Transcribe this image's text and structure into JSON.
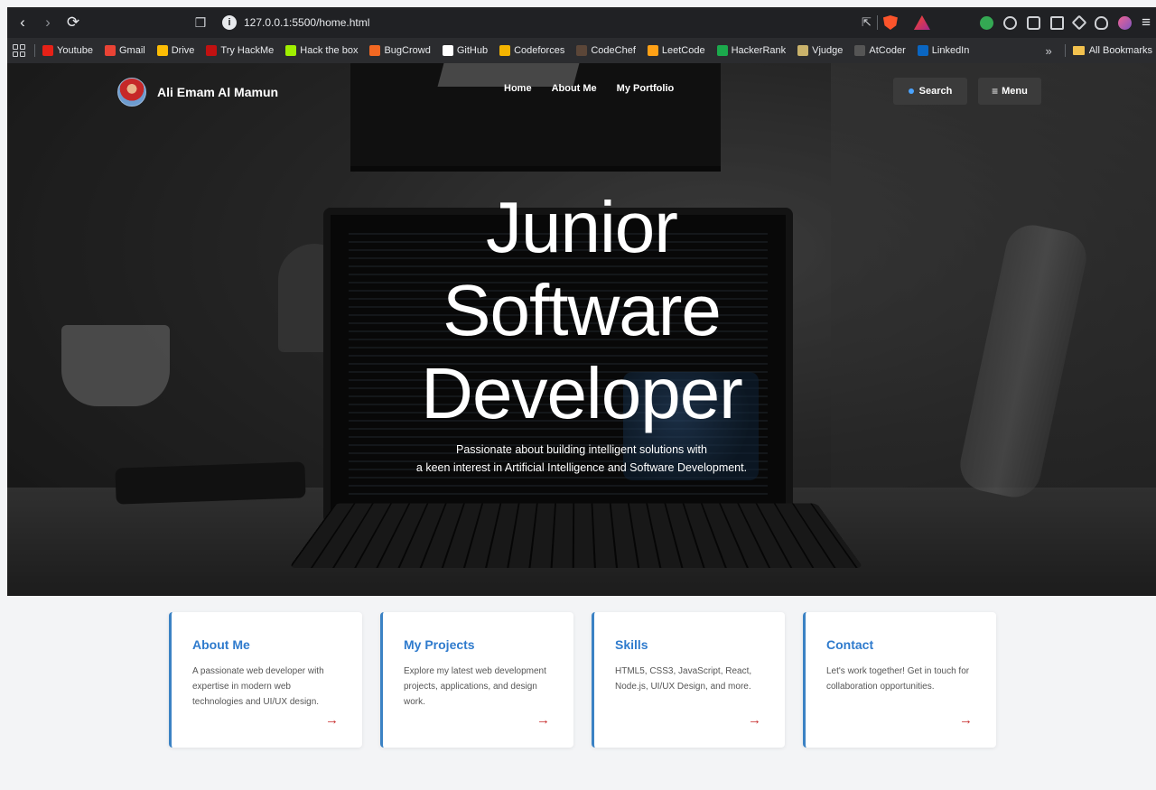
{
  "browser": {
    "url": "127.0.0.1:5500/home.html",
    "bookmarks": [
      {
        "label": "Youtube",
        "icon": "youtube-icon",
        "color": "#e62117"
      },
      {
        "label": "Gmail",
        "icon": "gmail-icon",
        "color": "#ea4335"
      },
      {
        "label": "Drive",
        "icon": "drive-icon",
        "color": "#fbbc04"
      },
      {
        "label": "Try HackMe",
        "icon": "tryhackme-icon",
        "color": "#c11111"
      },
      {
        "label": "Hack the box",
        "icon": "hackthebox-icon",
        "color": "#9fef00"
      },
      {
        "label": "BugCrowd",
        "icon": "bugcrowd-icon",
        "color": "#f26822"
      },
      {
        "label": "GitHub",
        "icon": "github-icon",
        "color": "#ffffff"
      },
      {
        "label": "Codeforces",
        "icon": "codeforces-icon",
        "color": "#f4b400"
      },
      {
        "label": "CodeChef",
        "icon": "codechef-icon",
        "color": "#5b4638"
      },
      {
        "label": "LeetCode",
        "icon": "leetcode-icon",
        "color": "#ffa116"
      },
      {
        "label": "HackerRank",
        "icon": "hackerrank-icon",
        "color": "#1ba94c"
      },
      {
        "label": "Vjudge",
        "icon": "vjudge-icon",
        "color": "#c9b26b"
      },
      {
        "label": "AtCoder",
        "icon": "atcoder-icon",
        "color": "#555555"
      },
      {
        "label": "LinkedIn",
        "icon": "linkedin-icon",
        "color": "#0a66c2"
      }
    ],
    "overflow": "»",
    "all_bookmarks": "All Bookmarks"
  },
  "site": {
    "brand": "Ali Emam Al Mamun",
    "nav": [
      "Home",
      "About Me",
      "My Portfolio"
    ],
    "search_label": "Search",
    "menu_label": "Menu",
    "hero": {
      "title_lines": [
        "Junior",
        "Software",
        "Developer"
      ],
      "subtitle_lines": [
        "Passionate about building intelligent solutions with",
        "a keen interest in Artificial Intelligence and Software Development."
      ]
    },
    "cards": [
      {
        "title": "About Me",
        "desc": "A passionate web developer with expertise in modern web technologies and UI/UX design.",
        "arrow": "→"
      },
      {
        "title": "My Projects",
        "desc": "Explore my latest web development projects, applications, and design work.",
        "arrow": "→"
      },
      {
        "title": "Skills",
        "desc": "HTML5, CSS3, JavaScript, React, Node.js, UI/UX Design, and more.",
        "arrow": "→"
      },
      {
        "title": "Contact",
        "desc": "Let's work together! Get in touch for collaboration opportunities.",
        "arrow": "→"
      }
    ]
  },
  "colors": {
    "accent": "#2f7bcd",
    "arrow": "#c62828",
    "card_border": "#3b82c4"
  }
}
